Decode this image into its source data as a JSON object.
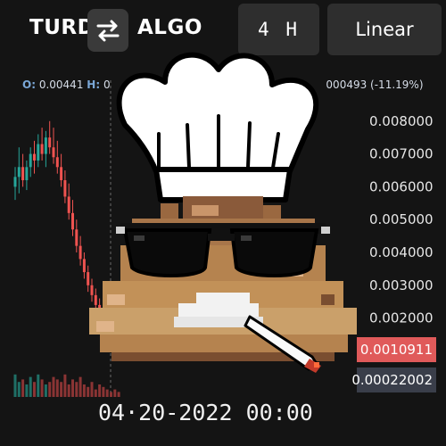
{
  "header": {
    "base_symbol": "TURD",
    "quote_symbol": "ALGO",
    "timeframe": "4 H",
    "scale_mode": "Linear",
    "swap_icon": "swap-arrows-icon"
  },
  "ohlc": {
    "open_key": "O:",
    "open_value": "0.00441",
    "high_key": "H:",
    "high_value": "0",
    "change_value": "000493 (-11.19%)"
  },
  "last_price": "0.0010911",
  "volume_value": "0.00022002",
  "crosshair_time": "04·20-2022 00:00",
  "mascot": {
    "type": "pixel-art",
    "description_icon": "chef-poop-mascot-icon"
  },
  "colors": {
    "up": "#26a69a",
    "down": "#ef5350",
    "last_price_tag": "#e05a5a",
    "accent": "#7aa7d6"
  },
  "chart_data": {
    "type": "candlestick",
    "title": "",
    "xlabel": "",
    "ylabel": "",
    "y_ticks": [
      "0.008000",
      "0.007000",
      "0.006000",
      "0.005000",
      "0.004000",
      "0.003000",
      "0.002000"
    ],
    "ylim": [
      0.00055,
      0.0087
    ],
    "grid": false,
    "candles": [
      {
        "o": 0.006,
        "h": 0.0066,
        "l": 0.0056,
        "c": 0.0063
      },
      {
        "o": 0.0063,
        "h": 0.0072,
        "l": 0.0058,
        "c": 0.0066
      },
      {
        "o": 0.0066,
        "h": 0.007,
        "l": 0.006,
        "c": 0.0062
      },
      {
        "o": 0.0062,
        "h": 0.0068,
        "l": 0.0059,
        "c": 0.0066
      },
      {
        "o": 0.0066,
        "h": 0.0072,
        "l": 0.0063,
        "c": 0.007
      },
      {
        "o": 0.007,
        "h": 0.0074,
        "l": 0.0064,
        "c": 0.0068
      },
      {
        "o": 0.0068,
        "h": 0.0076,
        "l": 0.0066,
        "c": 0.0073
      },
      {
        "o": 0.0073,
        "h": 0.0078,
        "l": 0.0068,
        "c": 0.007
      },
      {
        "o": 0.007,
        "h": 0.0077,
        "l": 0.0066,
        "c": 0.0075
      },
      {
        "o": 0.0075,
        "h": 0.008,
        "l": 0.007,
        "c": 0.0072
      },
      {
        "o": 0.0072,
        "h": 0.0078,
        "l": 0.0067,
        "c": 0.0069
      },
      {
        "o": 0.0069,
        "h": 0.0074,
        "l": 0.0064,
        "c": 0.0066
      },
      {
        "o": 0.0066,
        "h": 0.007,
        "l": 0.006,
        "c": 0.0062
      },
      {
        "o": 0.0062,
        "h": 0.0065,
        "l": 0.0055,
        "c": 0.0057
      },
      {
        "o": 0.0057,
        "h": 0.0061,
        "l": 0.005,
        "c": 0.0052
      },
      {
        "o": 0.0052,
        "h": 0.0056,
        "l": 0.0045,
        "c": 0.0047
      },
      {
        "o": 0.0047,
        "h": 0.005,
        "l": 0.004,
        "c": 0.0042
      },
      {
        "o": 0.0042,
        "h": 0.0045,
        "l": 0.0036,
        "c": 0.0038
      },
      {
        "o": 0.0038,
        "h": 0.004,
        "l": 0.0032,
        "c": 0.0034
      },
      {
        "o": 0.0034,
        "h": 0.0036,
        "l": 0.0028,
        "c": 0.003
      },
      {
        "o": 0.003,
        "h": 0.0032,
        "l": 0.0025,
        "c": 0.0027
      },
      {
        "o": 0.0027,
        "h": 0.0029,
        "l": 0.0022,
        "c": 0.0024
      },
      {
        "o": 0.0024,
        "h": 0.0026,
        "l": 0.002,
        "c": 0.0022
      },
      {
        "o": 0.0022,
        "h": 0.0023,
        "l": 0.0017,
        "c": 0.0019
      },
      {
        "o": 0.0019,
        "h": 0.0021,
        "l": 0.0015,
        "c": 0.0016
      },
      {
        "o": 0.0016,
        "h": 0.0018,
        "l": 0.0013,
        "c": 0.0014
      },
      {
        "o": 0.0014,
        "h": 0.0016,
        "l": 0.0012,
        "c": 0.0013
      },
      {
        "o": 0.0013,
        "h": 0.0014,
        "l": 0.0011,
        "c": 0.00109
      }
    ],
    "volumes": [
      0.9,
      0.6,
      0.7,
      0.5,
      0.8,
      0.6,
      0.9,
      0.7,
      0.5,
      0.6,
      0.8,
      0.7,
      0.6,
      0.9,
      0.5,
      0.7,
      0.6,
      0.8,
      0.5,
      0.4,
      0.6,
      0.3,
      0.5,
      0.4,
      0.3,
      0.2,
      0.3,
      0.2
    ]
  }
}
